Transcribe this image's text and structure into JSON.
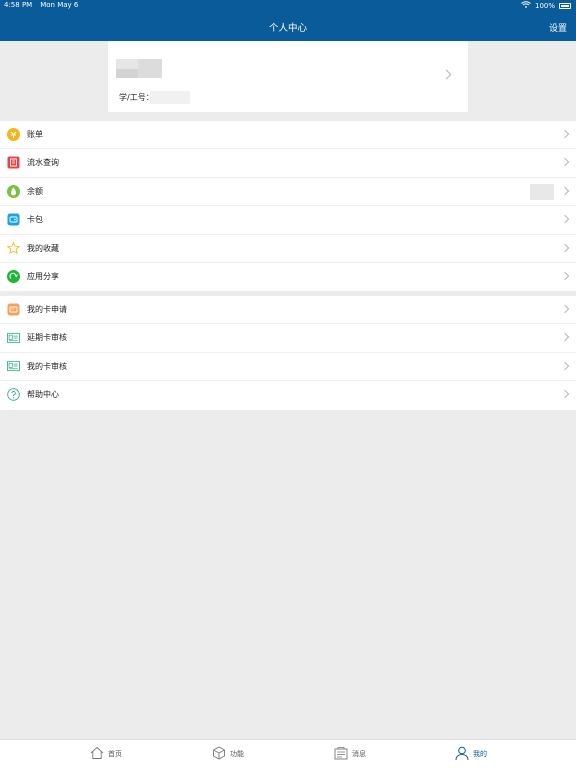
{
  "status_bar": {
    "time": "4:58 PM",
    "date": "Mon May 6",
    "battery": "100%"
  },
  "nav": {
    "title": "个人中心",
    "settings_label": "设置"
  },
  "profile": {
    "id_label": "学/工号："
  },
  "menu_group_1": [
    {
      "label": "账单",
      "icon": "bill-icon",
      "color": "#f5b51b"
    },
    {
      "label": "流水查询",
      "icon": "transactions-icon",
      "color": "#e94545"
    },
    {
      "label": "余额",
      "icon": "balance-icon",
      "color": "#7ac143"
    },
    {
      "label": "卡包",
      "icon": "card-wallet-icon",
      "color": "#1aa3e8"
    },
    {
      "label": "我的收藏",
      "icon": "star-icon",
      "color": "#f5b51b"
    },
    {
      "label": "应用分享",
      "icon": "share-icon",
      "color": "#1cb832"
    }
  ],
  "menu_group_2": [
    {
      "label": "我的卡申请",
      "icon": "card-apply-icon",
      "color": "#f5a25a"
    },
    {
      "label": "延期卡审核",
      "icon": "extend-card-review-icon",
      "color": "#2fae8e"
    },
    {
      "label": "我的卡审核",
      "icon": "my-card-review-icon",
      "color": "#2fae8e"
    },
    {
      "label": "帮助中心",
      "icon": "help-icon",
      "color": "#2fae8e"
    }
  ],
  "tabs": [
    {
      "label": "首页",
      "icon": "home-icon"
    },
    {
      "label": "功能",
      "icon": "cube-icon"
    },
    {
      "label": "消息",
      "icon": "message-icon"
    },
    {
      "label": "我的",
      "icon": "user-icon",
      "active": true
    }
  ],
  "colors": {
    "primary": "#0a5b9a",
    "background": "#ececec"
  }
}
